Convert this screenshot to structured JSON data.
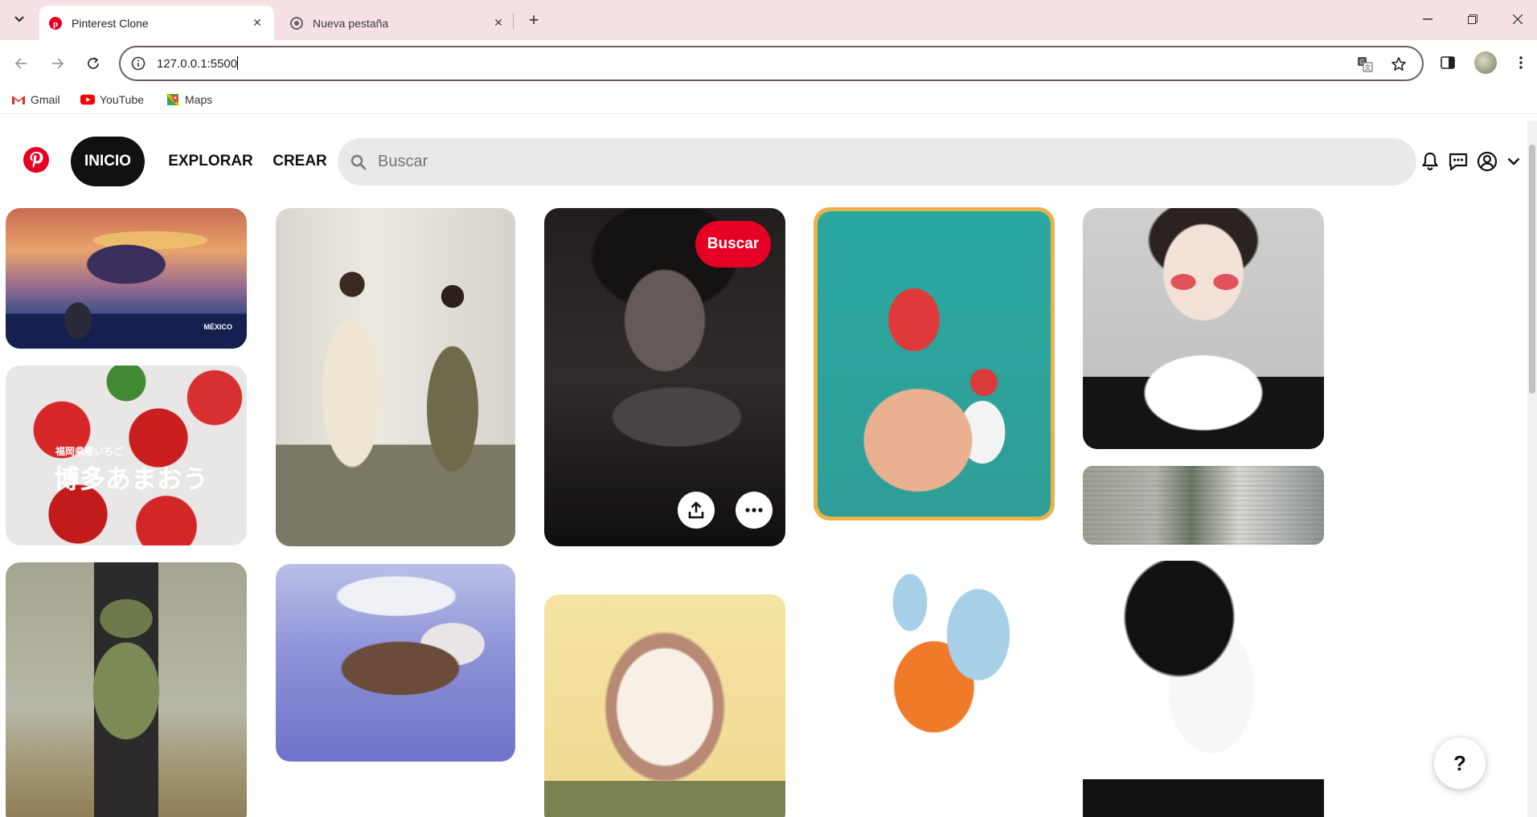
{
  "browser": {
    "tabs": [
      {
        "title": "Pinterest Clone",
        "active": true
      },
      {
        "title": "Nueva pestaña",
        "active": false
      }
    ],
    "url": "127.0.0.1:5500",
    "bookmarks": [
      {
        "label": "Gmail",
        "icon": "gmail-icon"
      },
      {
        "label": "YouTube",
        "icon": "youtube-icon"
      },
      {
        "label": "Maps",
        "icon": "maps-icon"
      }
    ]
  },
  "header": {
    "nav": {
      "home": "INICIO",
      "explore": "EXPLORAR",
      "create": "CREAR"
    },
    "search_placeholder": "Buscar"
  },
  "pins": {
    "featured": {
      "save_label": "Buscar"
    },
    "strawberry_caption_small": "福岡県産いちご",
    "strawberry_caption_large": "博多あまおう",
    "sea_caption": "MÉXICO"
  },
  "help_label": "?",
  "colors": {
    "brand_red": "#e60023",
    "tab_strip": "#f5e1e4",
    "search_bg": "#e9e9e9"
  }
}
